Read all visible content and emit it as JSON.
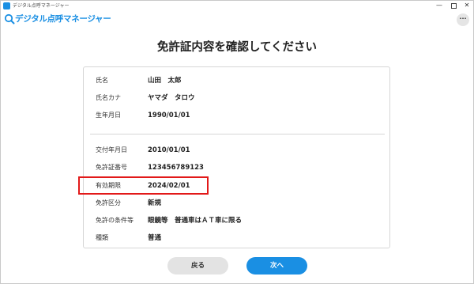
{
  "window": {
    "title": "デジタル点呼マネージャー",
    "min_glyph": "—",
    "close_glyph": "✕"
  },
  "app": {
    "brand": "デジタル点呼マネージャー",
    "more_glyph": "···"
  },
  "page": {
    "title": "免許証内容を確認してください"
  },
  "personal": [
    {
      "label": "氏名",
      "value": "山田　太郎"
    },
    {
      "label": "氏名カナ",
      "value": "ヤマダ　タロウ"
    },
    {
      "label": "生年月日",
      "value": "1990/01/01"
    }
  ],
  "license": [
    {
      "label": "交付年月日",
      "value": "2010/01/01"
    },
    {
      "label": "免許証番号",
      "value": "123456789123"
    },
    {
      "label": "有効期限",
      "value": "2024/02/01"
    },
    {
      "label": "免許区分",
      "value": "新規"
    },
    {
      "label": "免許の条件等",
      "value": "眼鏡等　普通車はＡＴ車に限る"
    },
    {
      "label": "種類",
      "value": "普通"
    }
  ],
  "buttons": {
    "back": "戻る",
    "next": "次へ"
  },
  "colors": {
    "accent": "#1a8fe3",
    "highlight": "#e21919"
  }
}
